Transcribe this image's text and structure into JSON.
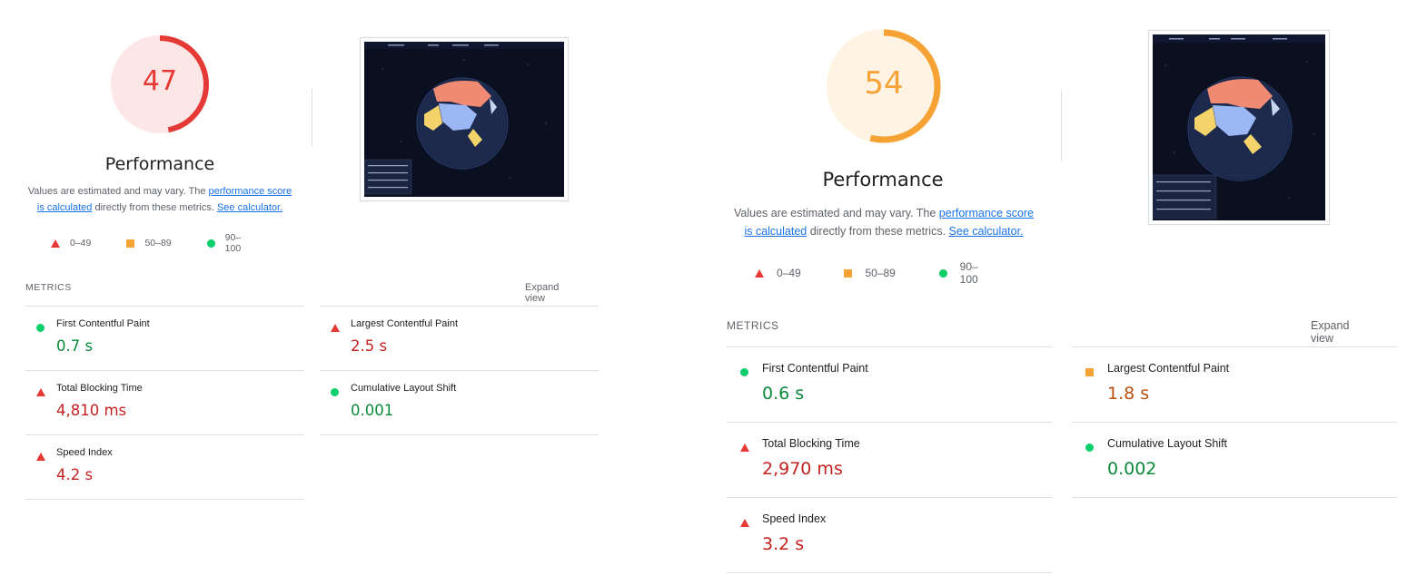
{
  "colors": {
    "fail": "#e53935",
    "average": "#f6a234",
    "pass": "#0cce6b"
  },
  "reports": [
    {
      "score": 47,
      "score_fraction": 0.47,
      "score_color": "#e53935",
      "score_bg": "#fde7e6",
      "category": "Performance",
      "desc_prefix": "Values are estimated and may vary. The ",
      "desc_link1_a": "performance score",
      "desc_link1_b": "is calculated",
      "desc_mid": " directly from these metrics.",
      "desc_link2": "See calculator.",
      "legend": [
        "0–49",
        "50–89",
        "90–100"
      ],
      "metrics_title": "METRICS",
      "expand_label": "Expand view",
      "metrics": [
        {
          "name": "First Contentful Paint",
          "value": "0.7 s",
          "status": "pass"
        },
        {
          "name": "Total Blocking Time",
          "value": "4,810 ms",
          "status": "fail"
        },
        {
          "name": "Speed Index",
          "value": "4.2 s",
          "status": "fail"
        },
        {
          "name": "Largest Contentful Paint",
          "value": "2.5 s",
          "status": "fail"
        },
        {
          "name": "Cumulative Layout Shift",
          "value": "0.001",
          "status": "pass"
        }
      ]
    },
    {
      "score": 54,
      "score_fraction": 0.54,
      "score_color": "#f6a234",
      "score_bg": "#fff4e4",
      "category": "Performance",
      "desc_prefix": "Values are estimated and may vary. The ",
      "desc_link1_a": "performance score",
      "desc_link1_b": "is calculated",
      "desc_mid": " directly from these metrics.",
      "desc_link2": "See calculator.",
      "legend": [
        "0–49",
        "50–89",
        "90–100"
      ],
      "metrics_title": "METRICS",
      "expand_label": "Expand view",
      "metrics": [
        {
          "name": "First Contentful Paint",
          "value": "0.6 s",
          "status": "pass"
        },
        {
          "name": "Total Blocking Time",
          "value": "2,970 ms",
          "status": "fail"
        },
        {
          "name": "Speed Index",
          "value": "3.2 s",
          "status": "fail"
        },
        {
          "name": "Largest Contentful Paint",
          "value": "1.8 s",
          "status": "average"
        },
        {
          "name": "Cumulative Layout Shift",
          "value": "0.002",
          "status": "pass"
        }
      ]
    }
  ]
}
